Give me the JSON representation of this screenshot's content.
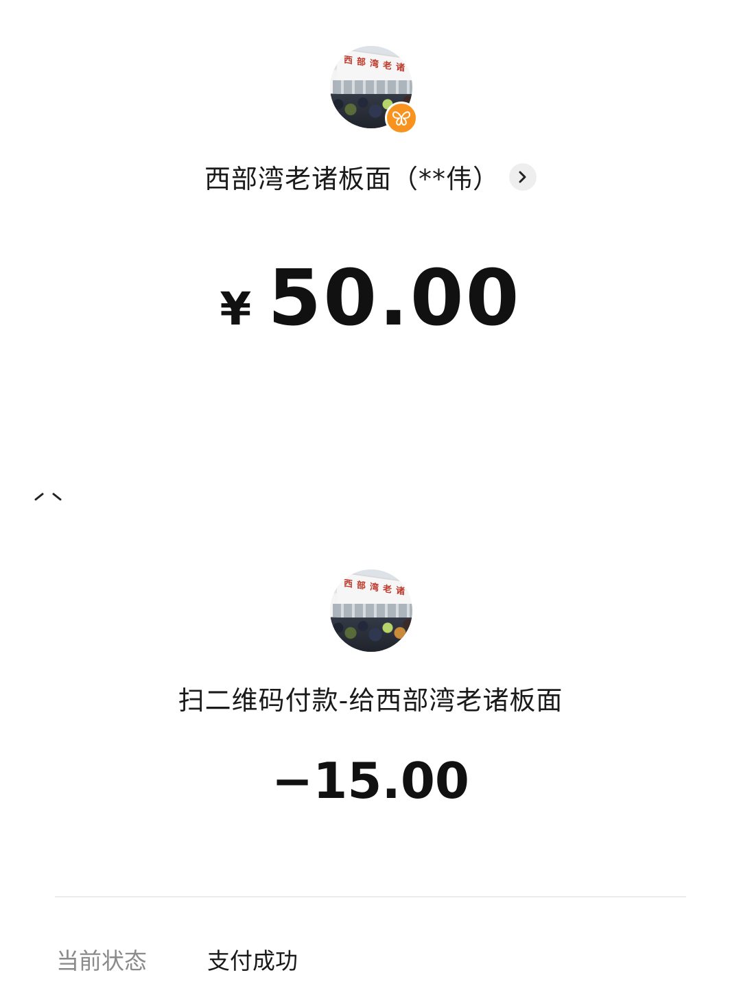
{
  "header": {
    "merchant_name": "西部湾老诸板面（**伟）",
    "amount_currency": "¥",
    "amount_value": "50.00",
    "avatar_sign_text": "西部湾老诸板面",
    "badge_icon": "butterfly-icon",
    "badge_color": "#f7931e"
  },
  "transaction": {
    "avatar_sign_text": "西部湾老诸板面",
    "description": "扫二维码付款-给西部湾老诸板面",
    "amount": "−15.00"
  },
  "details": {
    "status_label": "当前状态",
    "status_value": "支付成功"
  }
}
